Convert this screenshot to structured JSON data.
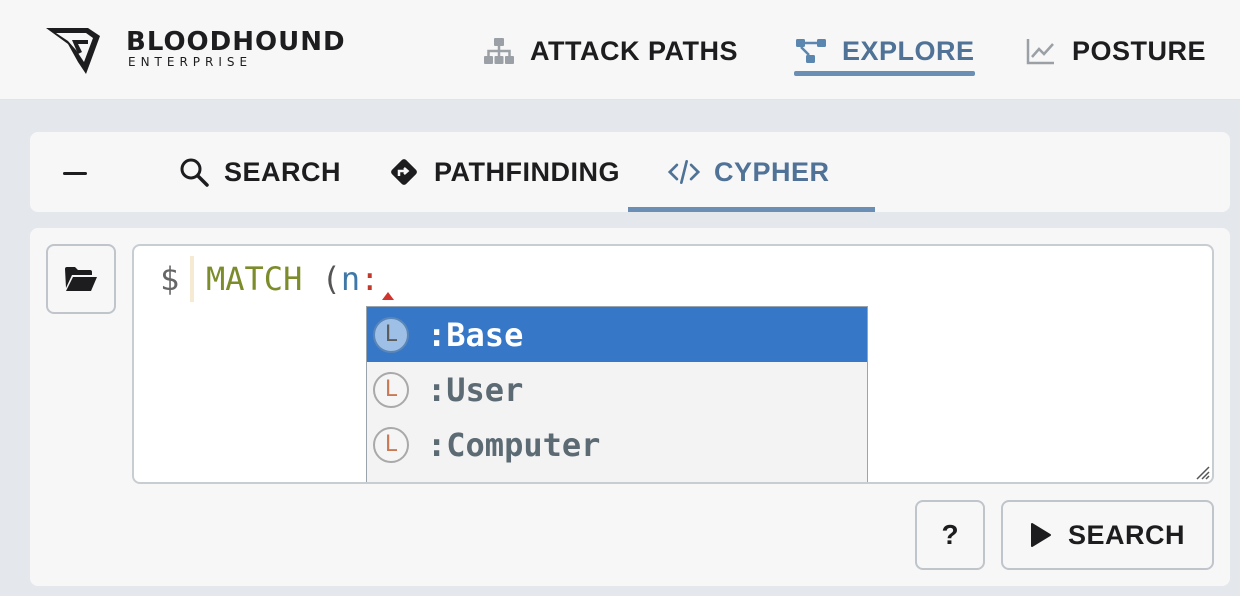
{
  "header": {
    "brand_title": "BLOODHOUND",
    "brand_subtitle": "ENTERPRISE",
    "nav": [
      {
        "label": "ATTACK PATHS",
        "icon": "sitemap-icon",
        "active": false
      },
      {
        "label": "EXPLORE",
        "icon": "graph-icon",
        "active": true
      },
      {
        "label": "POSTURE",
        "icon": "line-chart-icon",
        "active": false
      }
    ],
    "accent_color": "#4f7296"
  },
  "explore_tabs": {
    "collapse_icon": "minus-icon",
    "tabs": [
      {
        "label": "SEARCH",
        "icon": "search-icon",
        "active": false
      },
      {
        "label": "PATHFINDING",
        "icon": "route-sign-icon",
        "active": false
      },
      {
        "label": "CYPHER",
        "icon": "code-icon",
        "active": true
      }
    ]
  },
  "cypher": {
    "prompt": "$",
    "query_keyword": "MATCH",
    "query_paren": "(",
    "query_var": "n",
    "query_colon": ":",
    "autocomplete": [
      {
        "badge": "L",
        "label": ":Base",
        "selected": true
      },
      {
        "badge": "L",
        "label": ":User",
        "selected": false
      },
      {
        "badge": "L",
        "label": ":Computer",
        "selected": false
      }
    ],
    "folder_icon": "folder-open-icon",
    "help_label": "?",
    "search_label": "SEARCH",
    "selection_color": "#3777c8"
  }
}
